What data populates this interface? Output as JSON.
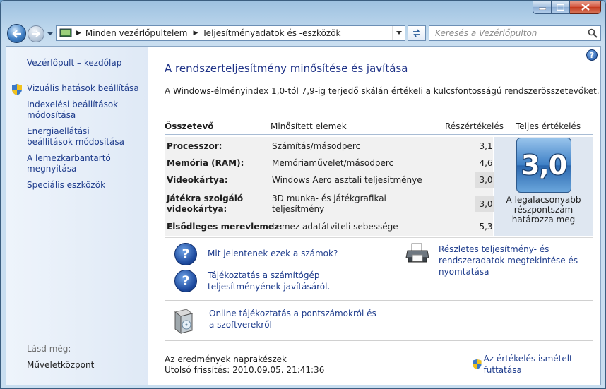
{
  "nav": {
    "breadcrumb": [
      "Minden vezérlőpultelem",
      "Teljesítményadatok és -eszközök"
    ],
    "search_placeholder": "Keresés a Vezérlőpulton"
  },
  "sidebar": {
    "items": [
      {
        "label": "Vezérlőpult – kezdőlap"
      },
      {
        "label": "Vizuális hatások beállítása"
      },
      {
        "label": "Indexelési beállítások módosítása"
      },
      {
        "label": "Energiaellátási beállítások módosítása"
      },
      {
        "label": "A lemezkarbantartó megnyitása"
      },
      {
        "label": "Speciális eszközök"
      }
    ],
    "see_also_label": "Lásd még:",
    "see_also_items": [
      {
        "label": "Műveletközpont"
      }
    ]
  },
  "main": {
    "title": "A rendszerteljesítmény minősítése és javítása",
    "description": "A Windows-élményindex 1,0-tól 7,9-ig terjedő skálán értékeli a kulcsfontosságú rendszerösszetevőket.",
    "table": {
      "headers": {
        "component": "Összetevő",
        "item": "Minősített elemek",
        "subscore": "Részértékelés",
        "total": "Teljes értékelés"
      },
      "rows": [
        {
          "component": "Processzor:",
          "item": "Számítás/másodperc",
          "score": "3,1"
        },
        {
          "component": "Memória (RAM):",
          "item": "Memóriaművelet/másodperc",
          "score": "4,6"
        },
        {
          "component": "Videokártya:",
          "item": "Windows Aero asztali teljesítménye",
          "score": "3,0"
        },
        {
          "component": "Játékra szolgáló videokártya:",
          "item": "3D munka- és játékgrafikai teljesítmény",
          "score": "3,0"
        },
        {
          "component": "Elsődleges merevlemez:",
          "item": "Lemez adatátviteli sebessége",
          "score": "5,3"
        }
      ],
      "base_score": "3,0",
      "base_note": "A legalacsonyabb részpontszám határozza meg"
    },
    "links": {
      "what_numbers": "Mit jelentenek ezek a számok?",
      "improve": "Tájékoztatás a számítógép teljesítményének javításáról.",
      "details": "Részletes teljesítmény- és rendszeradatok megtekintése és nyomtatása",
      "online": "Online tájékoztatás a pontszámokról és a szoftverekről"
    },
    "status": {
      "current": "Az eredmények naprakészek",
      "last_update": "Utolsó frissítés: 2010.09.05. 21:41:36"
    },
    "rerun_label": "Az értékelés ismételt futtatása"
  }
}
